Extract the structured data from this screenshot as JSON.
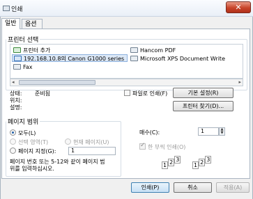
{
  "window": {
    "title": "인쇄",
    "close_glyph": "✕"
  },
  "tabs": [
    {
      "label": "일반"
    },
    {
      "label": "옵션"
    }
  ],
  "printer_select": {
    "legend": "프린터 선택",
    "printers": [
      {
        "name": "프린터 추가",
        "icon": "add-printer-icon"
      },
      {
        "name": "Hancom PDF",
        "icon": "printer-icon"
      },
      {
        "name": "192.168.10.8의 Canon G1000 series",
        "icon": "network-printer-icon"
      },
      {
        "name": "Microsoft XPS Document Write",
        "icon": "printer-icon"
      },
      {
        "name": "Fax",
        "icon": "fax-icon"
      }
    ],
    "scroll_left": "◂",
    "scroll_right": "▸"
  },
  "status": {
    "status_label": "상태:",
    "status_value": "준비됨",
    "location_label": "위치:",
    "comment_label": "설명:",
    "print_to_file": "파일로 인쇄(F)",
    "preferences_button": "기본 설정(R)",
    "find_printer_button": "프린터 찾기(D)..."
  },
  "page_range": {
    "legend": "페이지 범위",
    "all": "모두(L)",
    "selection": "선택 영역(T)",
    "current_page": "현재 페이지(U)",
    "pages": "페이지 지정(G):",
    "pages_value": "1",
    "hint_line1": "페이지 번호 또는 5-12와 같이 페이지 범",
    "hint_line2": "위를 입력하십시오."
  },
  "copies": {
    "label": "매수(C):",
    "value": "1",
    "collate": "한 부씩 인쇄(O)",
    "spin_up": "▲",
    "spin_down": "▼",
    "collate_pages": [
      "1",
      "2",
      "3"
    ]
  },
  "buttons": {
    "print": "인쇄(P)",
    "cancel": "취소",
    "apply": "적용(A)"
  }
}
